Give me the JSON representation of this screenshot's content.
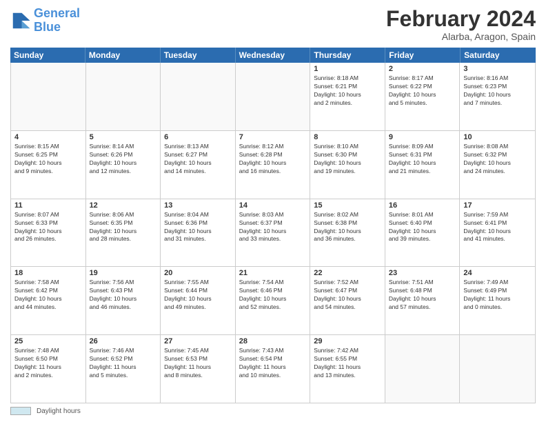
{
  "logo": {
    "line1": "General",
    "line2": "Blue"
  },
  "title": "February 2024",
  "subtitle": "Alarba, Aragon, Spain",
  "days_of_week": [
    "Sunday",
    "Monday",
    "Tuesday",
    "Wednesday",
    "Thursday",
    "Friday",
    "Saturday"
  ],
  "legend_label": "Daylight hours",
  "weeks": [
    [
      {
        "day": "",
        "info": ""
      },
      {
        "day": "",
        "info": ""
      },
      {
        "day": "",
        "info": ""
      },
      {
        "day": "",
        "info": ""
      },
      {
        "day": "1",
        "info": "Sunrise: 8:18 AM\nSunset: 6:21 PM\nDaylight: 10 hours\nand 2 minutes."
      },
      {
        "day": "2",
        "info": "Sunrise: 8:17 AM\nSunset: 6:22 PM\nDaylight: 10 hours\nand 5 minutes."
      },
      {
        "day": "3",
        "info": "Sunrise: 8:16 AM\nSunset: 6:23 PM\nDaylight: 10 hours\nand 7 minutes."
      }
    ],
    [
      {
        "day": "4",
        "info": "Sunrise: 8:15 AM\nSunset: 6:25 PM\nDaylight: 10 hours\nand 9 minutes."
      },
      {
        "day": "5",
        "info": "Sunrise: 8:14 AM\nSunset: 6:26 PM\nDaylight: 10 hours\nand 12 minutes."
      },
      {
        "day": "6",
        "info": "Sunrise: 8:13 AM\nSunset: 6:27 PM\nDaylight: 10 hours\nand 14 minutes."
      },
      {
        "day": "7",
        "info": "Sunrise: 8:12 AM\nSunset: 6:28 PM\nDaylight: 10 hours\nand 16 minutes."
      },
      {
        "day": "8",
        "info": "Sunrise: 8:10 AM\nSunset: 6:30 PM\nDaylight: 10 hours\nand 19 minutes."
      },
      {
        "day": "9",
        "info": "Sunrise: 8:09 AM\nSunset: 6:31 PM\nDaylight: 10 hours\nand 21 minutes."
      },
      {
        "day": "10",
        "info": "Sunrise: 8:08 AM\nSunset: 6:32 PM\nDaylight: 10 hours\nand 24 minutes."
      }
    ],
    [
      {
        "day": "11",
        "info": "Sunrise: 8:07 AM\nSunset: 6:33 PM\nDaylight: 10 hours\nand 26 minutes."
      },
      {
        "day": "12",
        "info": "Sunrise: 8:06 AM\nSunset: 6:35 PM\nDaylight: 10 hours\nand 28 minutes."
      },
      {
        "day": "13",
        "info": "Sunrise: 8:04 AM\nSunset: 6:36 PM\nDaylight: 10 hours\nand 31 minutes."
      },
      {
        "day": "14",
        "info": "Sunrise: 8:03 AM\nSunset: 6:37 PM\nDaylight: 10 hours\nand 33 minutes."
      },
      {
        "day": "15",
        "info": "Sunrise: 8:02 AM\nSunset: 6:38 PM\nDaylight: 10 hours\nand 36 minutes."
      },
      {
        "day": "16",
        "info": "Sunrise: 8:01 AM\nSunset: 6:40 PM\nDaylight: 10 hours\nand 39 minutes."
      },
      {
        "day": "17",
        "info": "Sunrise: 7:59 AM\nSunset: 6:41 PM\nDaylight: 10 hours\nand 41 minutes."
      }
    ],
    [
      {
        "day": "18",
        "info": "Sunrise: 7:58 AM\nSunset: 6:42 PM\nDaylight: 10 hours\nand 44 minutes."
      },
      {
        "day": "19",
        "info": "Sunrise: 7:56 AM\nSunset: 6:43 PM\nDaylight: 10 hours\nand 46 minutes."
      },
      {
        "day": "20",
        "info": "Sunrise: 7:55 AM\nSunset: 6:44 PM\nDaylight: 10 hours\nand 49 minutes."
      },
      {
        "day": "21",
        "info": "Sunrise: 7:54 AM\nSunset: 6:46 PM\nDaylight: 10 hours\nand 52 minutes."
      },
      {
        "day": "22",
        "info": "Sunrise: 7:52 AM\nSunset: 6:47 PM\nDaylight: 10 hours\nand 54 minutes."
      },
      {
        "day": "23",
        "info": "Sunrise: 7:51 AM\nSunset: 6:48 PM\nDaylight: 10 hours\nand 57 minutes."
      },
      {
        "day": "24",
        "info": "Sunrise: 7:49 AM\nSunset: 6:49 PM\nDaylight: 11 hours\nand 0 minutes."
      }
    ],
    [
      {
        "day": "25",
        "info": "Sunrise: 7:48 AM\nSunset: 6:50 PM\nDaylight: 11 hours\nand 2 minutes."
      },
      {
        "day": "26",
        "info": "Sunrise: 7:46 AM\nSunset: 6:52 PM\nDaylight: 11 hours\nand 5 minutes."
      },
      {
        "day": "27",
        "info": "Sunrise: 7:45 AM\nSunset: 6:53 PM\nDaylight: 11 hours\nand 8 minutes."
      },
      {
        "day": "28",
        "info": "Sunrise: 7:43 AM\nSunset: 6:54 PM\nDaylight: 11 hours\nand 10 minutes."
      },
      {
        "day": "29",
        "info": "Sunrise: 7:42 AM\nSunset: 6:55 PM\nDaylight: 11 hours\nand 13 minutes."
      },
      {
        "day": "",
        "info": ""
      },
      {
        "day": "",
        "info": ""
      }
    ]
  ]
}
